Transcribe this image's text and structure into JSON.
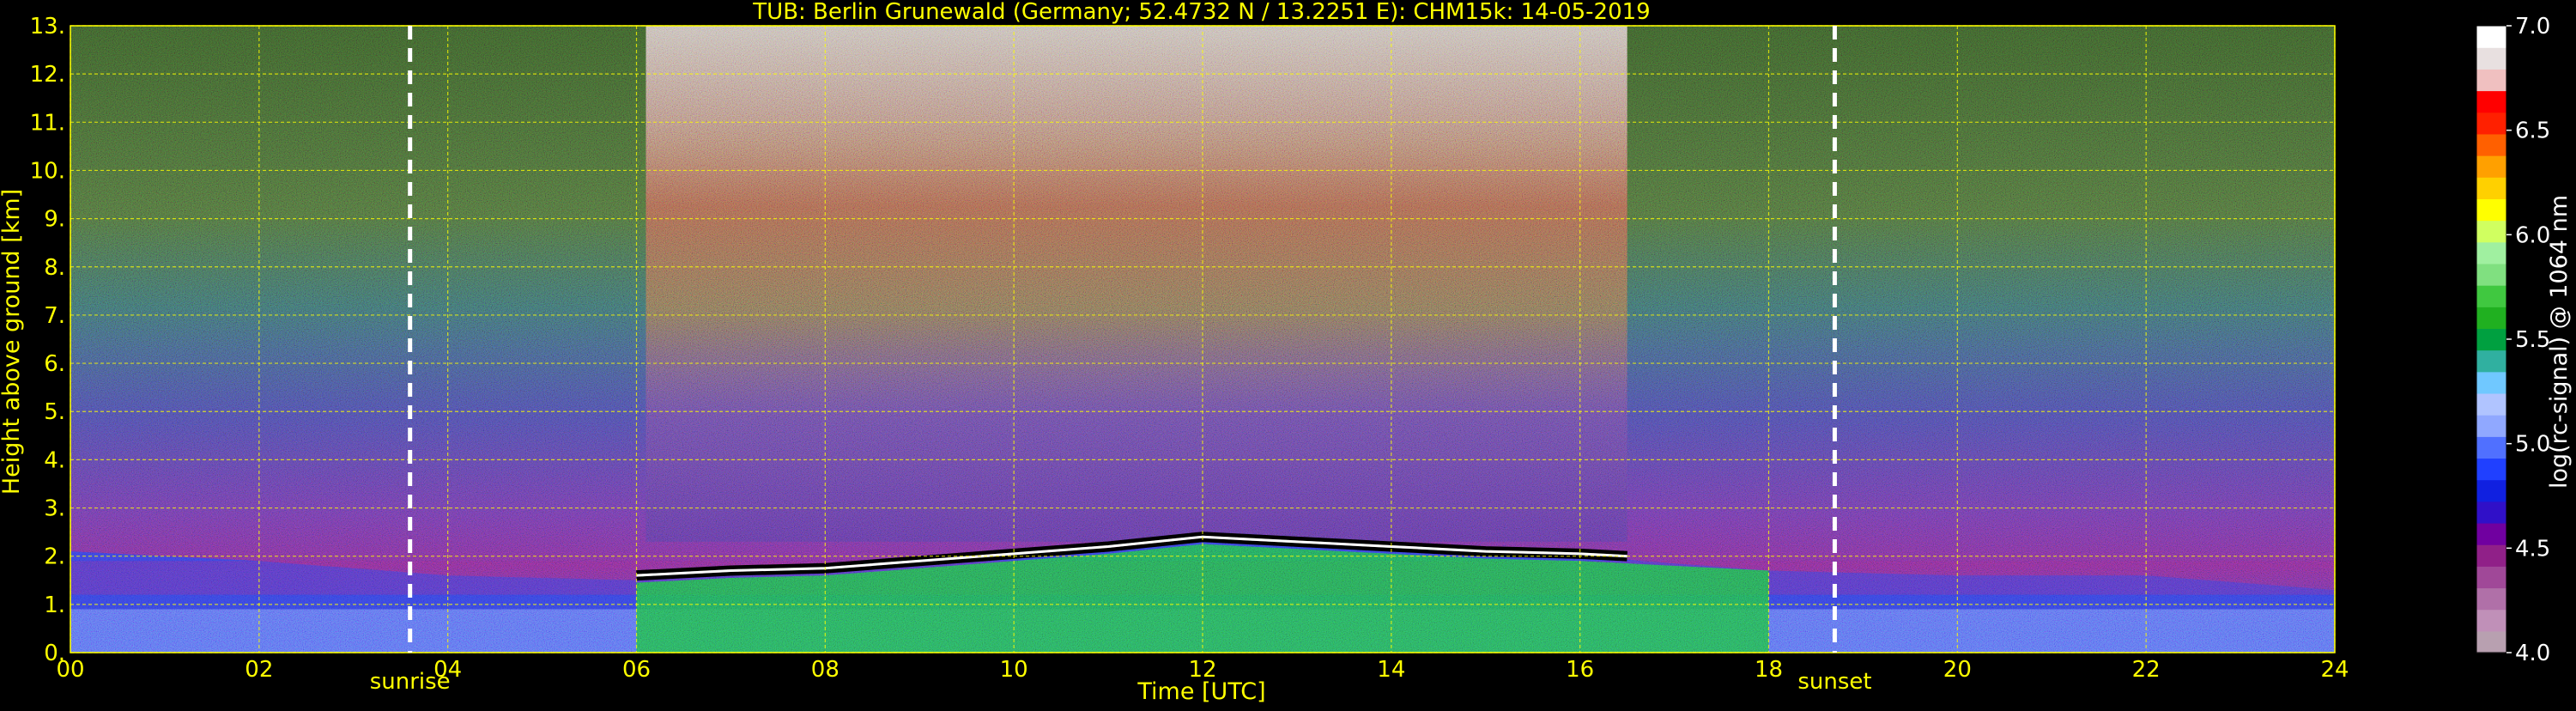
{
  "chart_data": {
    "type": "heatmap",
    "title": "TUB: Berlin Grunewald (Germany; 52.4732 N / 13.2251 E):    CHM15k: 14-05-2019",
    "xlabel": "Time [UTC]",
    "ylabel": "Height above ground [km]",
    "xlim": [
      0,
      24
    ],
    "ylim": [
      0,
      13
    ],
    "x_ticks": [
      "00",
      "02",
      "04",
      "06",
      "08",
      "10",
      "12",
      "14",
      "16",
      "18",
      "20",
      "22",
      "24"
    ],
    "y_ticks": [
      "0.",
      "1.",
      "2.",
      "3.",
      "4.",
      "5.",
      "6.",
      "7.",
      "8.",
      "9.",
      "10.",
      "11.",
      "12.",
      "13."
    ],
    "grid": true,
    "markers": [
      {
        "label": "sunrise",
        "x": 3.6
      },
      {
        "label": "sunset",
        "x": 18.7
      }
    ],
    "colorbar": {
      "label": "log(rc-signal) @ 1064 nm",
      "range": [
        4.0,
        7.0
      ],
      "ticks": [
        "4.0",
        "4.5",
        "5.0",
        "5.5",
        "6.0",
        "6.5",
        "7.0"
      ],
      "colors": [
        "#b8a0b0",
        "#c090b8",
        "#b070a8",
        "#a04898",
        "#902088",
        "#7000a0",
        "#3010c8",
        "#1020e0",
        "#2040ff",
        "#5070ff",
        "#90a8ff",
        "#b0c4ff",
        "#70c8ff",
        "#30b0a0",
        "#00a040",
        "#20b020",
        "#40c840",
        "#80e080",
        "#a0f0a0",
        "#d0ff60",
        "#ffff00",
        "#ffd000",
        "#ffa000",
        "#ff6000",
        "#ff2000",
        "#ff0000",
        "#f0c0c0",
        "#e8e0e0",
        "#ffffff"
      ]
    },
    "boundary_layer_top_km": [
      {
        "x": 0.0,
        "y": 2.1
      },
      {
        "x": 2.0,
        "y": 1.9
      },
      {
        "x": 4.0,
        "y": 1.6
      },
      {
        "x": 6.0,
        "y": 1.5
      },
      {
        "x": 8.0,
        "y": 1.8
      },
      {
        "x": 10.0,
        "y": 2.0
      },
      {
        "x": 12.0,
        "y": 2.4
      },
      {
        "x": 14.0,
        "y": 2.2
      },
      {
        "x": 16.0,
        "y": 2.0
      },
      {
        "x": 18.0,
        "y": 1.7
      },
      {
        "x": 20.0,
        "y": 1.6
      },
      {
        "x": 22.0,
        "y": 1.6
      },
      {
        "x": 24.0,
        "y": 1.3
      }
    ],
    "cloud_base_km": [
      {
        "x": 6.0,
        "y": 1.6
      },
      {
        "x": 7.0,
        "y": 1.7
      },
      {
        "x": 8.0,
        "y": 1.75
      },
      {
        "x": 9.0,
        "y": 1.9
      },
      {
        "x": 10.0,
        "y": 2.05
      },
      {
        "x": 11.0,
        "y": 2.2
      },
      {
        "x": 12.0,
        "y": 2.4
      },
      {
        "x": 13.0,
        "y": 2.3
      },
      {
        "x": 14.0,
        "y": 2.2
      },
      {
        "x": 15.0,
        "y": 2.1
      },
      {
        "x": 16.0,
        "y": 2.05
      },
      {
        "x": 16.5,
        "y": 2.0
      }
    ]
  }
}
